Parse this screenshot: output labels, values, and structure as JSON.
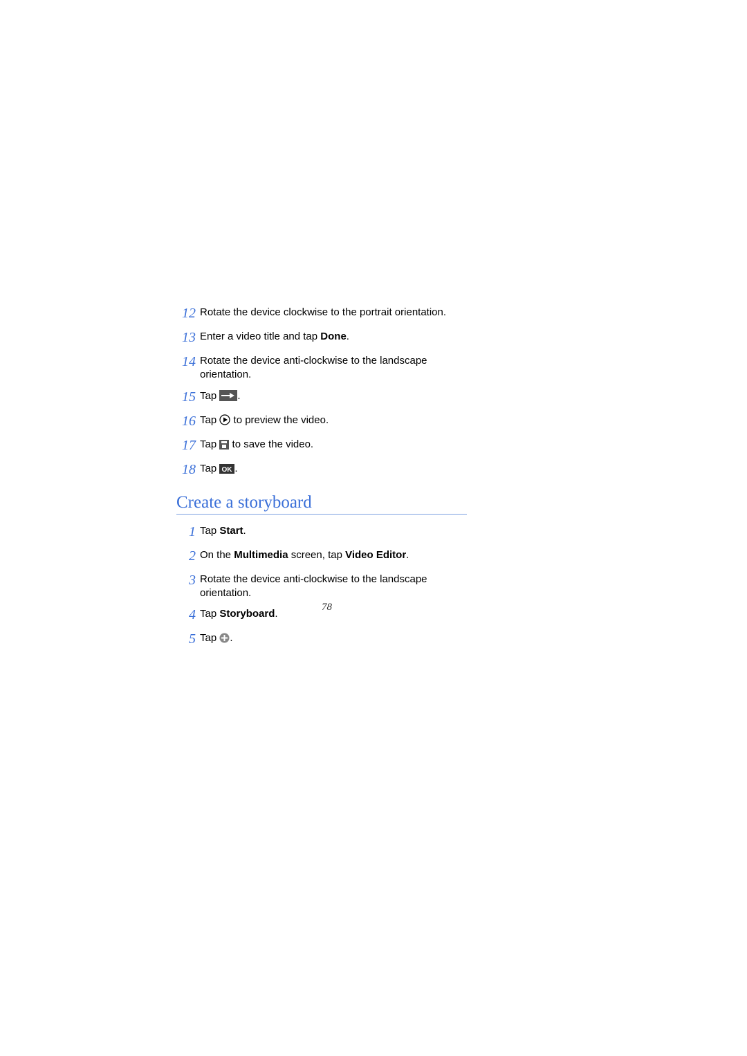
{
  "steps_top": [
    {
      "n": "12",
      "text": "Rotate the device clockwise to the portrait orientation."
    },
    {
      "n": "13",
      "parts": [
        "Enter a video title and tap ",
        {
          "bold": "Done"
        },
        "."
      ]
    },
    {
      "n": "14",
      "text": "Rotate the device anti-clockwise to the landscape orientation."
    },
    {
      "n": "15",
      "parts": [
        "Tap ",
        {
          "icon": "arrow-right-box-icon"
        },
        "."
      ]
    },
    {
      "n": "16",
      "parts": [
        "Tap ",
        {
          "icon": "play-circle-icon"
        },
        " to preview the video."
      ]
    },
    {
      "n": "17",
      "parts": [
        "Tap ",
        {
          "icon": "save-box-icon"
        },
        " to save the video."
      ]
    },
    {
      "n": "18",
      "parts": [
        "Tap ",
        {
          "icon": "ok-box-icon"
        },
        "."
      ]
    }
  ],
  "heading": "Create a storyboard",
  "steps_bottom": [
    {
      "n": "1",
      "parts": [
        "Tap ",
        {
          "bold": "Start"
        },
        "."
      ]
    },
    {
      "n": "2",
      "parts": [
        "On the ",
        {
          "bold": "Multimedia"
        },
        " screen, tap ",
        {
          "bold": "Video Editor"
        },
        "."
      ]
    },
    {
      "n": "3",
      "text": "Rotate the device anti-clockwise to the landscape orientation."
    },
    {
      "n": "4",
      "parts": [
        "Tap ",
        {
          "bold": "Storyboard"
        },
        "."
      ]
    },
    {
      "n": "5",
      "parts": [
        "Tap ",
        {
          "icon": "plus-circle-icon"
        },
        "."
      ]
    }
  ],
  "page_number": "78",
  "icons": {
    "arrow-right-box-icon": "arrow-right-box",
    "play-circle-icon": "play-circle",
    "save-box-icon": "save-box",
    "ok-box-icon": "ok-box",
    "plus-circle-icon": "plus-circle"
  }
}
